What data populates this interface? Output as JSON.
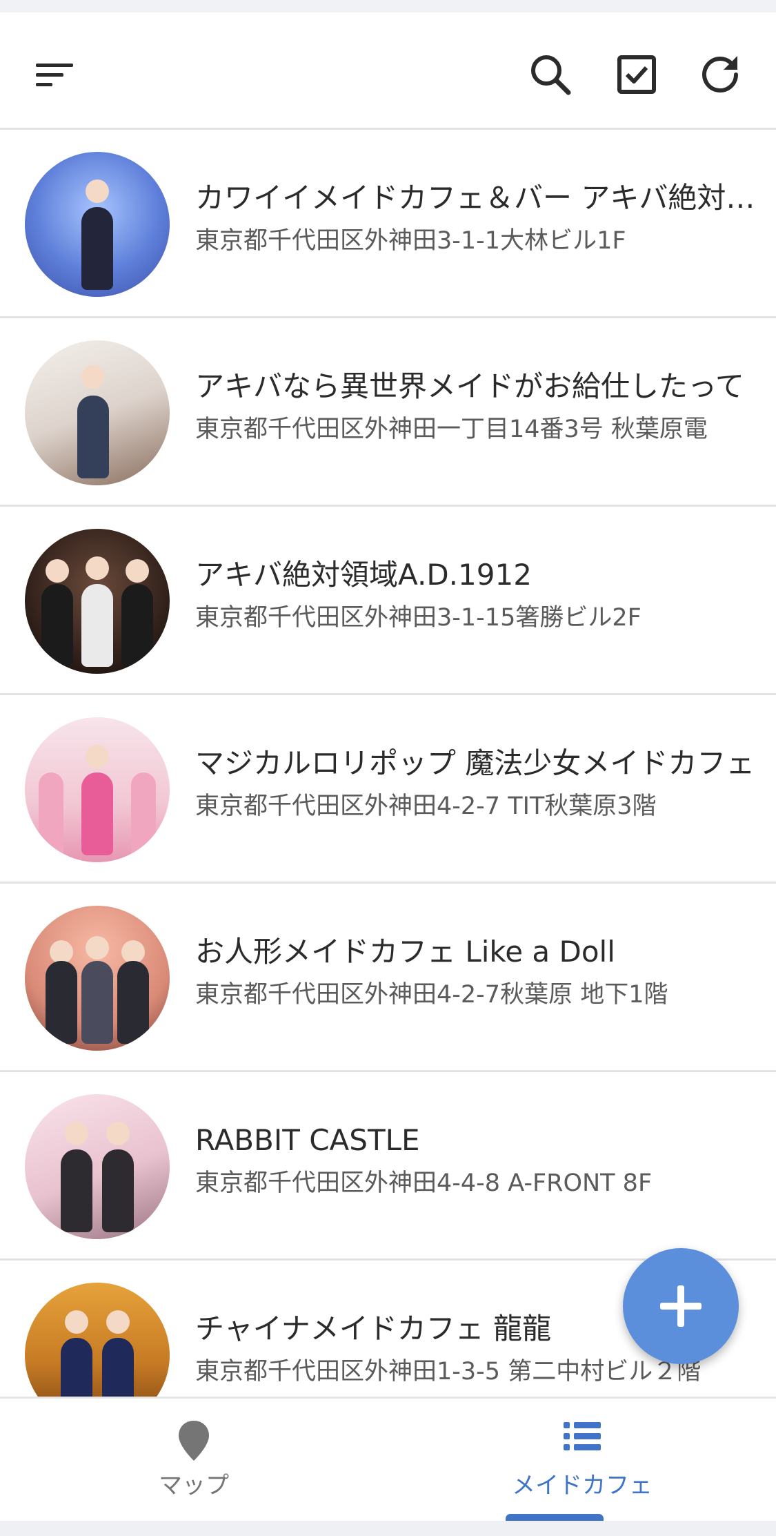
{
  "colors": {
    "accent": "#5b8fdc",
    "nav_active": "#3f74c8",
    "nav_inactive": "#757575",
    "divider": "#e2e2e2",
    "text_primary": "#2b2b2b",
    "text_secondary": "#5b5b5b"
  },
  "toolbar": {
    "menu_icon": "sort-lines-icon",
    "search_icon": "search-icon",
    "checkbox_icon": "checkbox-checked-icon",
    "refresh_icon": "refresh-icon"
  },
  "cafes": [
    {
      "name": "カワイイメイドカフェ＆バー アキバ絶対領域",
      "address": "東京都千代田区外神田3-1-1大林ビル1F"
    },
    {
      "name": "アキバなら異世界メイドがお給仕したって",
      "address": "東京都千代田区外神田一丁目14番3号 秋葉原電"
    },
    {
      "name": "アキバ絶対領域A.D.1912",
      "address": "東京都千代田区外神田3-1-15箸勝ビル2F"
    },
    {
      "name": "マジカルロリポップ 魔法少女メイドカフェ",
      "address": "東京都千代田区外神田4-2-7 TIT秋葉原3階"
    },
    {
      "name": "お人形メイドカフェ Like a Doll",
      "address": "東京都千代田区外神田4-2-7秋葉原 地下1階"
    },
    {
      "name": "RABBIT CASTLE",
      "address": "東京都千代田区外神田4-4-8 A-FRONT 8F"
    },
    {
      "name": "チャイナメイドカフェ 龍龍",
      "address": "東京都千代田区外神田1-3-5 第二中村ビル２階"
    }
  ],
  "fab": {
    "icon": "plus-icon"
  },
  "bottom_nav": {
    "items": [
      {
        "label": "マップ",
        "icon": "map-pin-icon",
        "active": false
      },
      {
        "label": "メイドカフェ",
        "icon": "list-icon",
        "active": true
      }
    ]
  }
}
